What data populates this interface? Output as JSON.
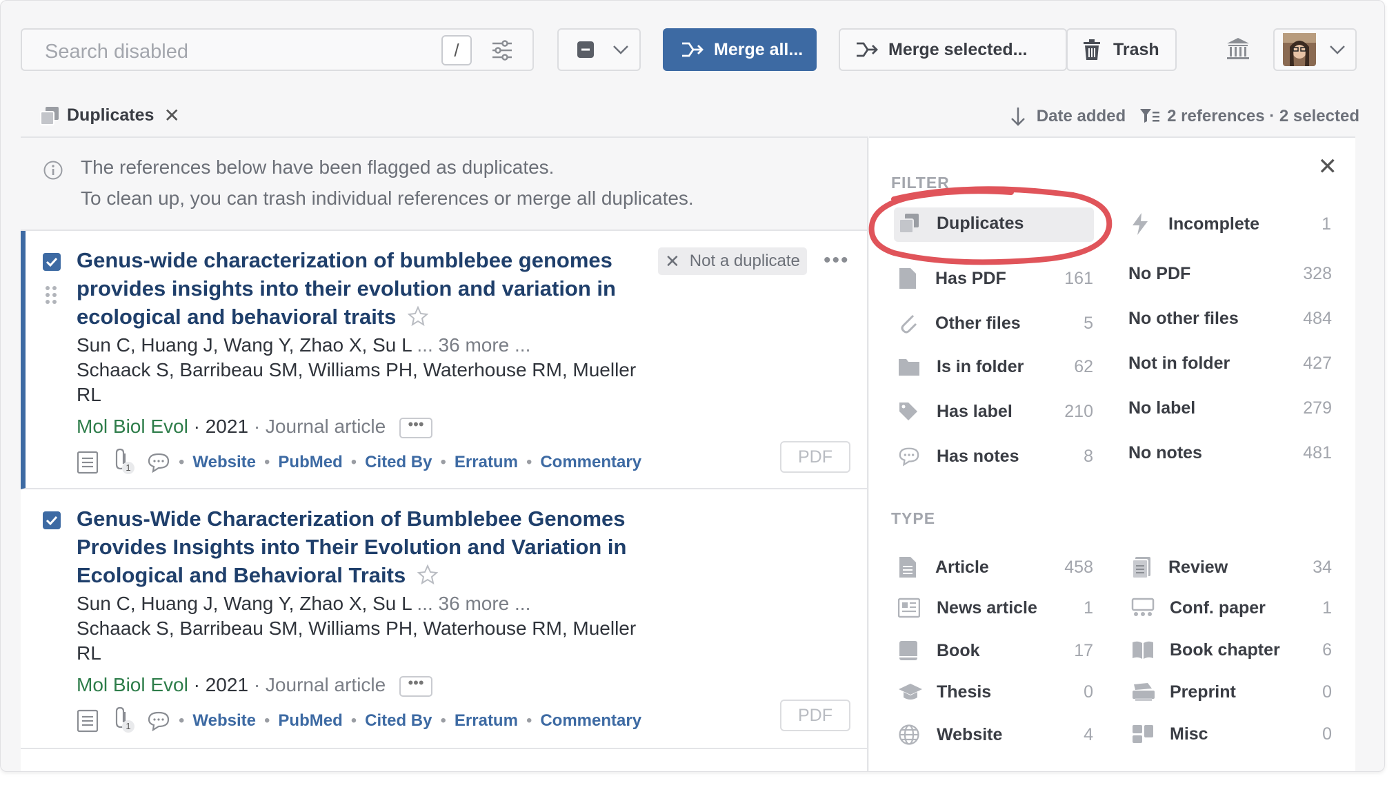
{
  "toolbar": {
    "search_placeholder": "Search disabled",
    "slash_key": "/",
    "merge_all": "Merge all...",
    "merge_selected": "Merge selected...",
    "trash": "Trash"
  },
  "crumb": {
    "label": "Duplicates"
  },
  "sort": {
    "label": "Date added",
    "summary": "2 references · 2 selected"
  },
  "notice": {
    "line1": "The references below have been flagged as duplicates.",
    "line2": "To clean up, you can trash individual references or merge all duplicates."
  },
  "references": [
    {
      "title": "Genus-wide characterization of bumblebee genomes provides insights into their evolution and variation in ecological and behavioral traits",
      "authors_lead": "Sun C, Huang J, Wang Y, Zhao X, Su L",
      "authors_more": "... 36 more ...",
      "authors_tail": "Schaack S, Barribeau SM, Williams PH, Waterhouse RM, Mueller RL",
      "journal": "Mol Biol Evol",
      "year": "2021",
      "kind": "Journal article",
      "not_duplicate": "Not a duplicate",
      "links": [
        "Website",
        "PubMed",
        "Cited By",
        "Erratum",
        "Commentary"
      ],
      "attachments": "1",
      "pdf": "PDF"
    },
    {
      "title": "Genus-Wide Characterization of Bumblebee Genomes Provides Insights into Their Evolution and Variation in Ecological and Behavioral Traits",
      "authors_lead": "Sun C, Huang J, Wang Y, Zhao X, Su L",
      "authors_more": "... 36 more ...",
      "authors_tail": "Schaack S, Barribeau SM, Williams PH, Waterhouse RM, Mueller RL",
      "journal": "Mol Biol Evol",
      "year": "2021",
      "kind": "Journal article",
      "links": [
        "Website",
        "PubMed",
        "Cited By",
        "Erratum",
        "Commentary"
      ],
      "attachments": "1",
      "pdf": "PDF"
    }
  ],
  "filter": {
    "heading": "FILTER",
    "duplicates": "Duplicates",
    "incomplete": {
      "label": "Incomplete",
      "count": "1"
    },
    "rows": [
      {
        "left": "Has PDF",
        "lcount": "161",
        "right": "No PDF",
        "rcount": "328"
      },
      {
        "left": "Other files",
        "lcount": "5",
        "right": "No other files",
        "rcount": "484"
      },
      {
        "left": "Is in folder",
        "lcount": "62",
        "right": "Not in folder",
        "rcount": "427"
      },
      {
        "left": "Has label",
        "lcount": "210",
        "right": "No label",
        "rcount": "279"
      },
      {
        "left": "Has notes",
        "lcount": "8",
        "right": "No notes",
        "rcount": "481"
      }
    ]
  },
  "type": {
    "heading": "TYPE",
    "rows": [
      {
        "left": "Article",
        "lcount": "458",
        "right": "Review",
        "rcount": "34"
      },
      {
        "left": "News article",
        "lcount": "1",
        "right": "Conf. paper",
        "rcount": "1"
      },
      {
        "left": "Book",
        "lcount": "17",
        "right": "Book chapter",
        "rcount": "6"
      },
      {
        "left": "Thesis",
        "lcount": "0",
        "right": "Preprint",
        "rcount": "0"
      },
      {
        "left": "Website",
        "lcount": "4",
        "right": "Misc",
        "rcount": "0"
      }
    ]
  },
  "colors": {
    "accent": "#3d6aa3",
    "highlight_ring": "#e0545a",
    "journal": "#2e7d4a"
  }
}
